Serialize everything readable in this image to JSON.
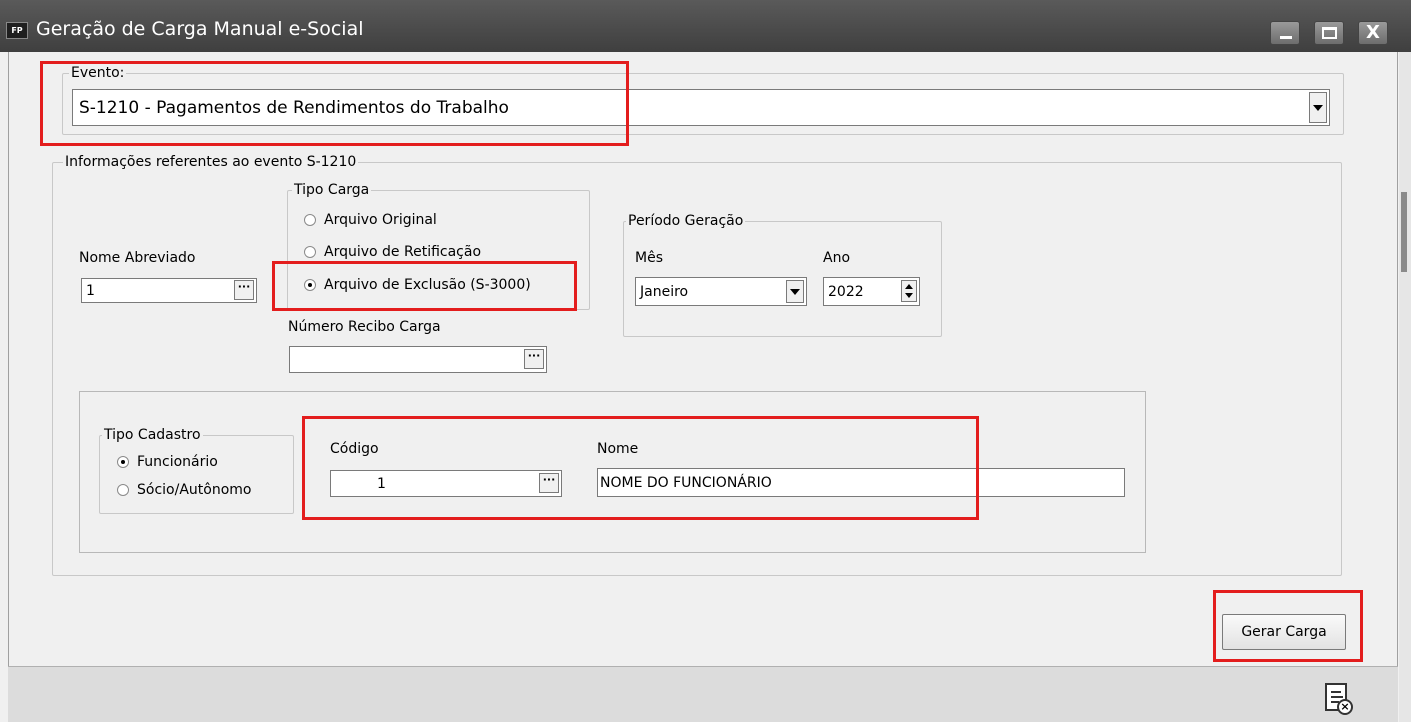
{
  "window": {
    "app_icon_text": "FP",
    "title": "Geração de Carga Manual e-Social",
    "buttons": {
      "minimize": "minimize",
      "maximize": "maximize",
      "close": "X"
    }
  },
  "evento": {
    "legend": "Evento:",
    "selected": "S-1210 - Pagamentos de Rendimentos do Trabalho"
  },
  "info": {
    "legend": "Informações referentes ao evento S-1210",
    "nome_abreviado": {
      "label": "Nome Abreviado",
      "value": "1",
      "button": "···"
    },
    "tipo_carga": {
      "legend": "Tipo Carga",
      "options": [
        {
          "label": "Arquivo Original",
          "selected": false
        },
        {
          "label": "Arquivo de Retificação",
          "selected": false
        },
        {
          "label": "Arquivo de Exclusão (S-3000)",
          "selected": true
        }
      ]
    },
    "numero_recibo": {
      "label": "Número Recibo Carga",
      "value": "",
      "button": "···"
    },
    "periodo": {
      "legend": "Período Geração",
      "mes_label": "Mês",
      "mes_value": "Janeiro",
      "ano_label": "Ano",
      "ano_value": "2022"
    }
  },
  "cadastro": {
    "tipo": {
      "legend": "Tipo Cadastro",
      "options": [
        {
          "label": "Funcionário",
          "selected": true
        },
        {
          "label": "Sócio/Autônomo",
          "selected": false
        }
      ]
    },
    "codigo": {
      "label": "Código",
      "value": "1",
      "button": "···"
    },
    "nome": {
      "label": "Nome",
      "value": "NOME DO FUNCIONÁRIO"
    }
  },
  "actions": {
    "gerar": "Gerar Carga"
  },
  "colors": {
    "highlight": "#e31d1d",
    "titlebar": "#4a4a4a",
    "background": "#f0f0f0"
  }
}
